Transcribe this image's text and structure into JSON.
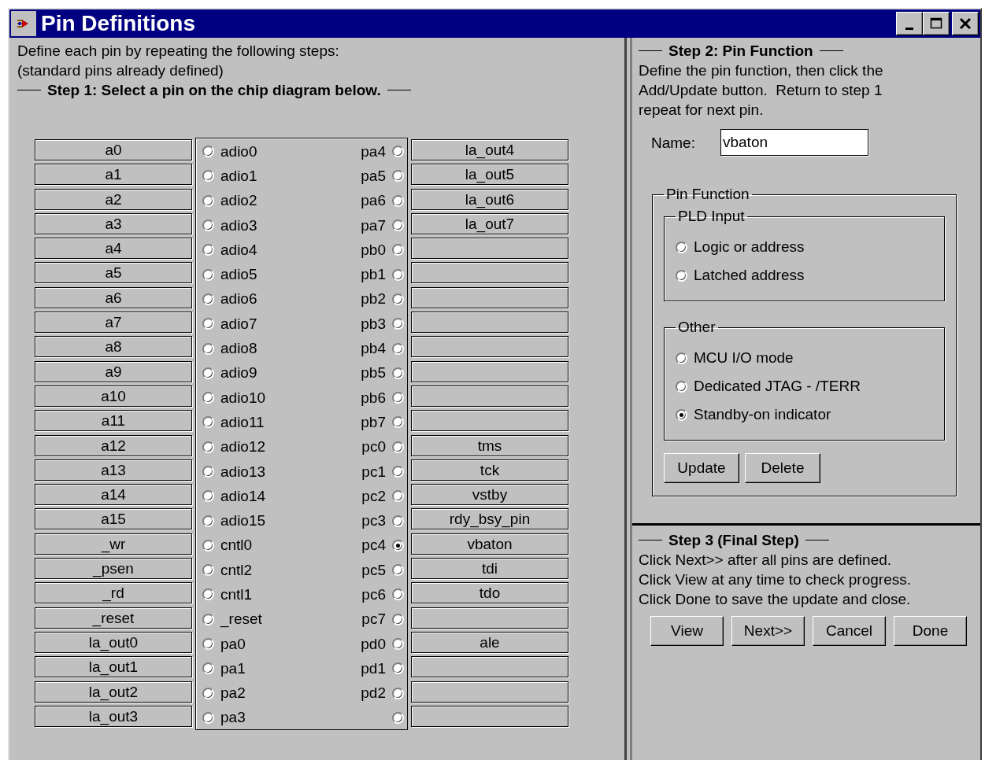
{
  "window": {
    "title": "Pin Definitions"
  },
  "step1": {
    "intro": [
      "Define each pin by repeating the following steps:",
      "(standard pins already defined)"
    ],
    "heading": "Step 1: Select a pin on the chip diagram below."
  },
  "pins": [
    {
      "left_label": "a0",
      "left_pin": "adio0",
      "left_selected": false,
      "right_pin": "pa4",
      "right_selected": false,
      "right_label": "la_out4"
    },
    {
      "left_label": "a1",
      "left_pin": "adio1",
      "left_selected": false,
      "right_pin": "pa5",
      "right_selected": false,
      "right_label": "la_out5"
    },
    {
      "left_label": "a2",
      "left_pin": "adio2",
      "left_selected": false,
      "right_pin": "pa6",
      "right_selected": false,
      "right_label": "la_out6"
    },
    {
      "left_label": "a3",
      "left_pin": "adio3",
      "left_selected": false,
      "right_pin": "pa7",
      "right_selected": false,
      "right_label": "la_out7"
    },
    {
      "left_label": "a4",
      "left_pin": "adio4",
      "left_selected": false,
      "right_pin": "pb0",
      "right_selected": false
    },
    {
      "left_label": "a5",
      "left_pin": "adio5",
      "left_selected": false,
      "right_pin": "pb1",
      "right_selected": false
    },
    {
      "left_label": "a6",
      "left_pin": "adio6",
      "left_selected": false,
      "right_pin": "pb2",
      "right_selected": false
    },
    {
      "left_label": "a7",
      "left_pin": "adio7",
      "left_selected": false,
      "right_pin": "pb3",
      "right_selected": false
    },
    {
      "left_label": "a8",
      "left_pin": "adio8",
      "left_selected": false,
      "right_pin": "pb4",
      "right_selected": false
    },
    {
      "left_label": "a9",
      "left_pin": "adio9",
      "left_selected": false,
      "right_pin": "pb5",
      "right_selected": false
    },
    {
      "left_label": "a10",
      "left_pin": "adio10",
      "left_selected": false,
      "right_pin": "pb6",
      "right_selected": false
    },
    {
      "left_label": "a11",
      "left_pin": "adio11",
      "left_selected": false,
      "right_pin": "pb7",
      "right_selected": false
    },
    {
      "left_label": "a12",
      "left_pin": "adio12",
      "left_selected": false,
      "right_pin": "pc0",
      "right_selected": false,
      "right_label": "tms"
    },
    {
      "left_label": "a13",
      "left_pin": "adio13",
      "left_selected": false,
      "right_pin": "pc1",
      "right_selected": false,
      "right_label": "tck"
    },
    {
      "left_label": "a14",
      "left_pin": "adio14",
      "left_selected": false,
      "right_pin": "pc2",
      "right_selected": false,
      "right_label": "vstby"
    },
    {
      "left_label": "a15",
      "left_pin": "adio15",
      "left_selected": false,
      "right_pin": "pc3",
      "right_selected": false,
      "right_label": "rdy_bsy_pin"
    },
    {
      "left_label": "_wr",
      "left_pin": "cntl0",
      "left_selected": false,
      "right_pin": "pc4",
      "right_selected": true,
      "right_label": "vbaton"
    },
    {
      "left_label": "_psen",
      "left_pin": "cntl2",
      "left_selected": false,
      "right_pin": "pc5",
      "right_selected": false,
      "right_label": "tdi"
    },
    {
      "left_label": "_rd",
      "left_pin": "cntl1",
      "left_selected": false,
      "right_pin": "pc6",
      "right_selected": false,
      "right_label": "tdo"
    },
    {
      "left_label": "_reset",
      "left_pin": "_reset",
      "left_selected": false,
      "right_pin": "pc7",
      "right_selected": false
    },
    {
      "left_label": "la_out0",
      "left_pin": "pa0",
      "left_selected": false,
      "right_pin": "pd0",
      "right_selected": false,
      "right_label": "ale"
    },
    {
      "left_label": "la_out1",
      "left_pin": "pa1",
      "left_selected": false,
      "right_pin": "pd1",
      "right_selected": false
    },
    {
      "left_label": "la_out2",
      "left_pin": "pa2",
      "left_selected": false,
      "right_pin": "pd2",
      "right_selected": false
    },
    {
      "left_label": "la_out3",
      "left_pin": "pa3",
      "left_selected": false,
      "right_selected": false
    }
  ],
  "step2": {
    "heading": "Step 2: Pin Function",
    "description": [
      "Define the pin function, then click the",
      "Add/Update button.  Return to step 1",
      "repeat for next pin."
    ],
    "name_label": "Name:",
    "name_value": "vbaton",
    "group_title": "Pin Function",
    "groups": [
      {
        "title": "PLD Input",
        "options": [
          {
            "label": "Logic or address",
            "selected": false
          },
          {
            "label": "Latched address",
            "selected": false
          }
        ]
      },
      {
        "title": "Other",
        "options": [
          {
            "label": "MCU I/O mode",
            "selected": false
          },
          {
            "label": "Dedicated JTAG - /TERR",
            "selected": false
          },
          {
            "label": "Standby-on indicator",
            "selected": true
          }
        ]
      }
    ],
    "buttons": [
      "Update",
      "Delete"
    ]
  },
  "step3": {
    "heading": "Step 3 (Final Step)",
    "lines": [
      "Click Next>> after all pins are defined.",
      "Click View at any time to check progress.",
      "Click Done to save the update and close."
    ],
    "buttons": [
      "View",
      "Next>>",
      "Cancel",
      "Done"
    ]
  }
}
